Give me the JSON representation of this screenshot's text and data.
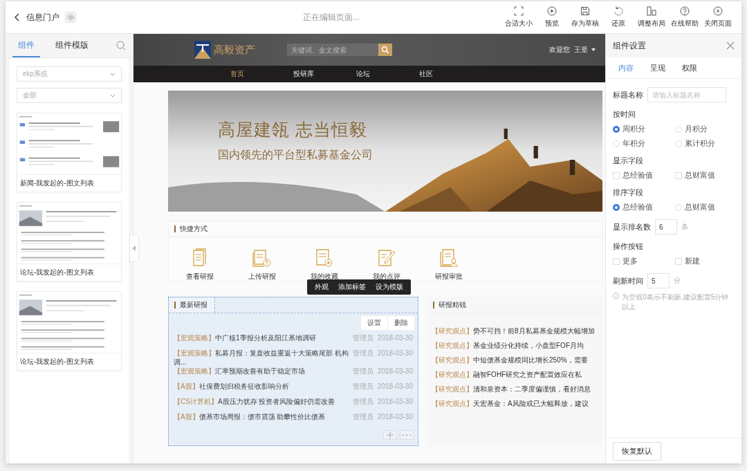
{
  "topbar": {
    "back_label": "信息门户",
    "status": "正在编辑页面...",
    "actions": [
      {
        "label": "合适大小"
      },
      {
        "label": "预览"
      },
      {
        "label": "存为草稿"
      },
      {
        "label": "还原"
      },
      {
        "label": "调整布局"
      },
      {
        "label": "在线帮助"
      },
      {
        "label": "关闭页面"
      }
    ]
  },
  "left_panel": {
    "tabs": [
      {
        "label": "组件",
        "selected": true
      },
      {
        "label": "组件模版",
        "selected": false
      }
    ],
    "selects": [
      "ekp系统",
      "全部"
    ],
    "templates": [
      {
        "name": "新闻-我发起的-图文列表",
        "kind": "news"
      },
      {
        "name": "论坛-我发起的-图文列表",
        "kind": "forum"
      },
      {
        "name": "论坛-我发起的-图文列表",
        "kind": "forum"
      }
    ]
  },
  "site": {
    "logo": "高毅资产",
    "search_placeholder": "关键词、全文搜索",
    "user": "欢迎您  王坚",
    "nav": [
      {
        "label": "首页",
        "selected": true
      },
      {
        "label": "投研库",
        "selected": false
      },
      {
        "label": "论坛",
        "selected": false
      },
      {
        "label": "社区",
        "selected": false
      }
    ],
    "banner": {
      "title": "高屋建瓴  志当恒毅",
      "subtitle": "国内领先的平台型私募基金公司"
    },
    "shortcuts": {
      "title": "快捷方式",
      "items": [
        {
          "label": "查看研报"
        },
        {
          "label": "上传研报"
        },
        {
          "label": "我的收藏"
        },
        {
          "label": "我的点评"
        },
        {
          "label": "研报审批"
        }
      ]
    },
    "widget_toolbar": [
      "外观",
      "添加标签",
      "设为模版"
    ],
    "latest": {
      "title": "最新研报",
      "selected": true,
      "actions": [
        "设置",
        "删除"
      ],
      "rows": [
        {
          "tag": "【宏观策略】",
          "title": "中广核1季报分析及阳江基地调研",
          "author": "管理员",
          "date": "2018-03-30"
        },
        {
          "tag": "【宏观策略】",
          "title": "私募月报：复盘收益重返十大策略尾部 机构调...",
          "author": "管理员",
          "date": "2018-03-30"
        },
        {
          "tag": "【宏观策略】",
          "title": "汇率预期改善有助于稳定市场",
          "author": "管理员",
          "date": "2018-03-30"
        },
        {
          "tag": "【A股】",
          "title": "社保费划归税务征收影响分析",
          "author": "管理员",
          "date": "2018-03-30"
        },
        {
          "tag": "【CS计算机】",
          "title": "A股压力犹存 投资者风险偏好仍需改善",
          "author": "管理员",
          "date": "2018-03-30"
        },
        {
          "tag": "【A股】",
          "title": "债基市场周报：债市震荡 助攀性价比债基",
          "author": "管理员",
          "date": "2018-03-30"
        }
      ]
    },
    "insights": {
      "title": "研报精锐",
      "rows": [
        {
          "tag": "【研究观点】",
          "text": "势不可挡！前8月私募基金规模大幅增加"
        },
        {
          "tag": "【研究观点】",
          "text": "基金业绩分化持续，小盘型FOF月均"
        },
        {
          "tag": "【研究观点】",
          "text": "中短债基金规模同比增长250%，需要"
        },
        {
          "tag": "【研究观点】",
          "text": "融智FOHF研究之资产配置效应在私"
        },
        {
          "tag": "【研究观点】",
          "text": "清和泉资本：二季度偏谨慎，看好消息"
        },
        {
          "tag": "【研究观点】",
          "text": "天宏基金：A风险或已大幅释放，建议"
        }
      ]
    }
  },
  "settings": {
    "title": "组件设置",
    "tabs": [
      {
        "label": "内容",
        "selected": true
      },
      {
        "label": "呈现",
        "selected": false
      },
      {
        "label": "权限",
        "selected": false
      }
    ],
    "title_field": {
      "label": "标题名称",
      "placeholder": "请输入标题名称"
    },
    "sections": [
      {
        "kind": "radio",
        "title": "按时间",
        "options": [
          {
            "label": "周积分",
            "selected": true
          },
          {
            "label": "月积分",
            "selected": false
          },
          {
            "label": "年积分",
            "selected": false
          },
          {
            "label": "累计积分",
            "selected": false
          }
        ]
      },
      {
        "kind": "checkbox",
        "title": "显示字段",
        "options": [
          {
            "label": "总经验值",
            "checked": false
          },
          {
            "label": "总财富值",
            "checked": false
          }
        ]
      },
      {
        "kind": "radio",
        "title": "排序字段",
        "options": [
          {
            "label": "总经验值",
            "selected": true
          },
          {
            "label": "总财富值",
            "selected": false
          }
        ]
      },
      {
        "kind": "number",
        "label": "显示排名数",
        "value": "6",
        "unit": "条"
      },
      {
        "kind": "checkbox",
        "title": "操作按钮",
        "options": [
          {
            "label": "更多",
            "checked": false
          },
          {
            "label": "新建",
            "checked": false
          }
        ]
      },
      {
        "kind": "number",
        "label": "刷新时间",
        "value": "5",
        "unit": "分",
        "hint": "为空或0表示不刷新,建议配置5分钟以上"
      }
    ],
    "reset_button": "恢复默认"
  }
}
